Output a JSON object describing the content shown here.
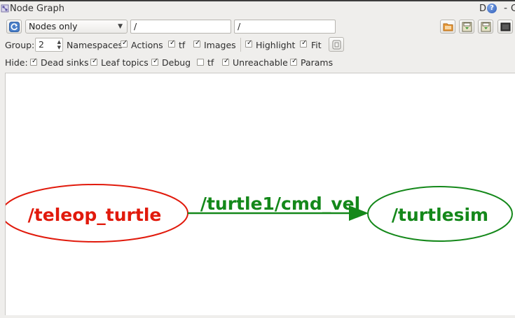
{
  "window": {
    "title": "Node Graph",
    "right_letter": "D",
    "help_glyph": "?",
    "minimize_glyph": "-",
    "close_glyph_cut": "C"
  },
  "toolbar": {
    "refresh_icon": "refresh-icon",
    "graph_mode": "Nodes only",
    "node_filter": "/",
    "topic_filter": "/",
    "right_icons": [
      "open-folder-icon",
      "save-dot-icon",
      "save-image-icon",
      "fullscreen-icon"
    ]
  },
  "options": {
    "group_label": "Group:",
    "group_value": "2",
    "namespaces": {
      "label": "Namespaces",
      "checked": true
    },
    "actions": {
      "label": "Actions",
      "checked": true
    },
    "tf": {
      "label": "tf",
      "checked": true
    },
    "images": {
      "label": "Images",
      "checked": true
    },
    "highlight": {
      "label": "Highlight",
      "checked": true
    },
    "fit": {
      "label": "Fit",
      "checked": true
    },
    "fit_button_icon": "fit-view-icon"
  },
  "hide": {
    "label": "Hide:",
    "dead_sinks": {
      "label": "Dead sinks",
      "checked": true
    },
    "leaf_topics": {
      "label": "Leaf topics",
      "checked": true
    },
    "debug": {
      "label": "Debug",
      "checked": true
    },
    "tf": {
      "label": "tf",
      "checked": false
    },
    "unreachable": {
      "label": "Unreachable",
      "checked": true
    },
    "params": {
      "label": "Params",
      "checked": true
    }
  },
  "graph": {
    "source_node": "/teleop_turtle",
    "target_node": "/turtlesim",
    "edge_label": "/turtle1/cmd_vel",
    "source_color": "#e11a0c",
    "target_color": "#14881a"
  }
}
